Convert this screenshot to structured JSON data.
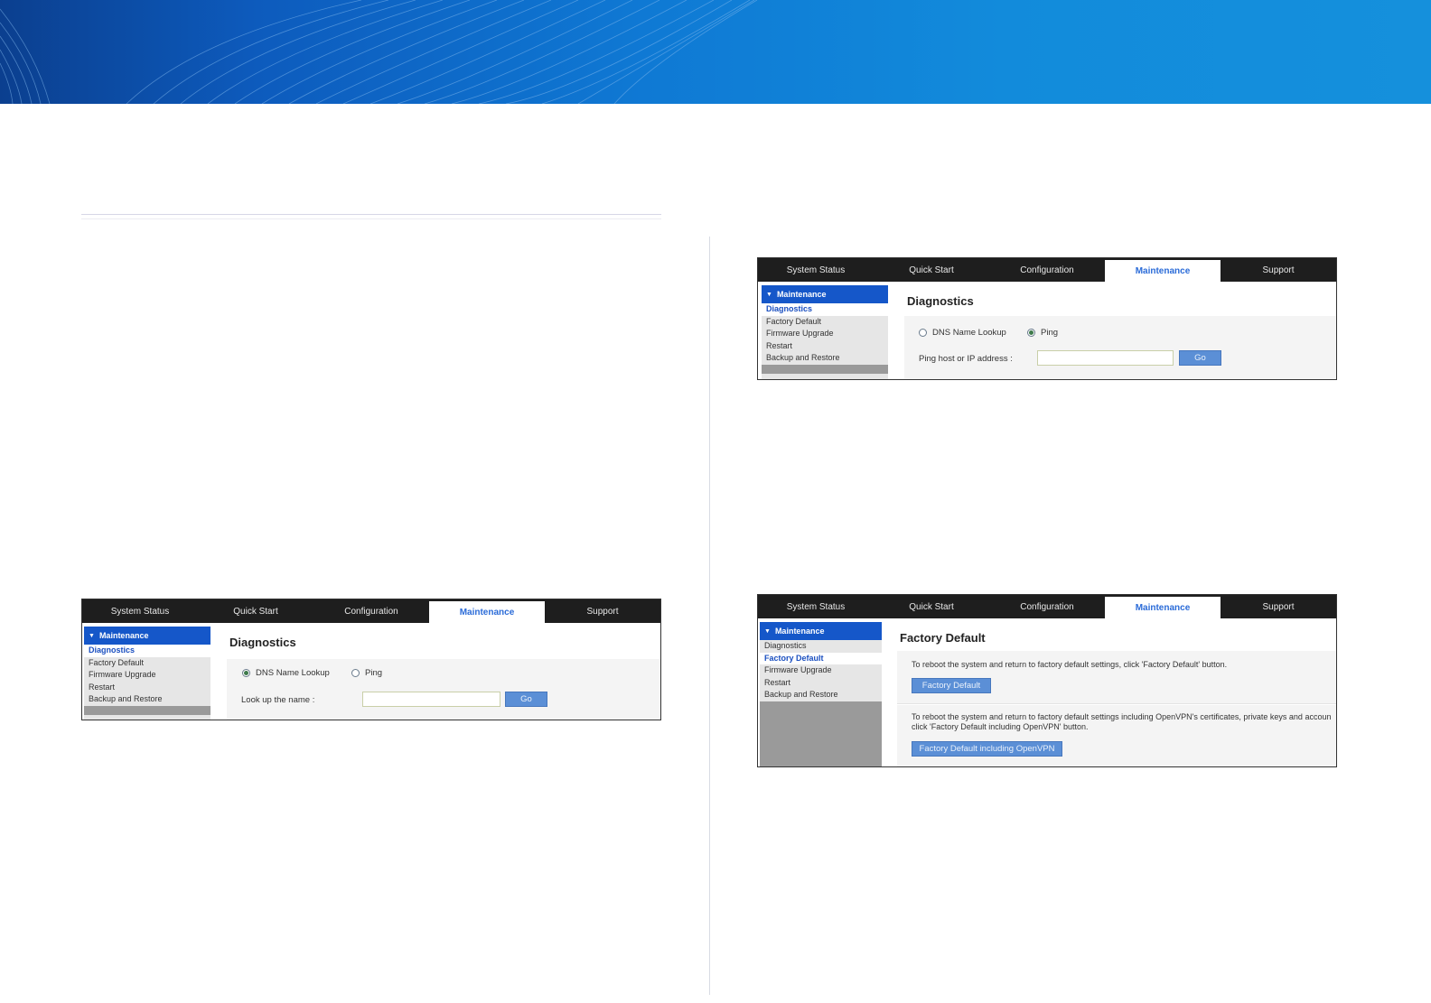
{
  "colors": {
    "banner_dark": "#0b3f8f",
    "banner_light": "#1590dc",
    "nav_bg": "#1e1e1e",
    "active_tab_text": "#2a6bd8",
    "sidebar_header": "#1557c9",
    "button": "#5b8fd6"
  },
  "panels": {
    "dns": {
      "tabs": [
        "System Status",
        "Quick Start",
        "Configuration",
        "Maintenance",
        "Support"
      ],
      "active_tab": "Maintenance",
      "sidebar": {
        "header": "Maintenance",
        "items": [
          "Diagnostics",
          "Factory Default",
          "Firmware Upgrade",
          "Restart",
          "Backup and Restore"
        ]
      },
      "title": "Diagnostics",
      "radio_dns": "DNS Name Lookup",
      "radio_ping": "Ping",
      "selected": "DNS Name Lookup",
      "field_label": "Look up the name :",
      "field_value": "",
      "go": "Go"
    },
    "ping": {
      "tabs": [
        "System Status",
        "Quick Start",
        "Configuration",
        "Maintenance",
        "Support"
      ],
      "active_tab": "Maintenance",
      "sidebar": {
        "header": "Maintenance",
        "items": [
          "Diagnostics",
          "Factory Default",
          "Firmware Upgrade",
          "Restart",
          "Backup and Restore"
        ]
      },
      "title": "Diagnostics",
      "radio_dns": "DNS Name Lookup",
      "radio_ping": "Ping",
      "selected": "Ping",
      "field_label": "Ping host or IP address :",
      "field_value": "",
      "go": "Go"
    },
    "factory": {
      "tabs": [
        "System Status",
        "Quick Start",
        "Configuration",
        "Maintenance",
        "Support"
      ],
      "active_tab": "Maintenance",
      "sidebar": {
        "header": "Maintenance",
        "items": [
          "Diagnostics",
          "Factory Default",
          "Firmware Upgrade",
          "Restart",
          "Backup and Restore"
        ]
      },
      "title": "Factory Default",
      "desc1": "To reboot the system and return to factory default settings, click 'Factory Default' button.",
      "button1": "Factory Default",
      "desc2_line1": "To reboot the system and return to factory default settings including OpenVPN's certificates, private keys and accoun",
      "desc2_line2": "click 'Factory Default including OpenVPN' button.",
      "button2": "Factory Default including OpenVPN"
    }
  }
}
